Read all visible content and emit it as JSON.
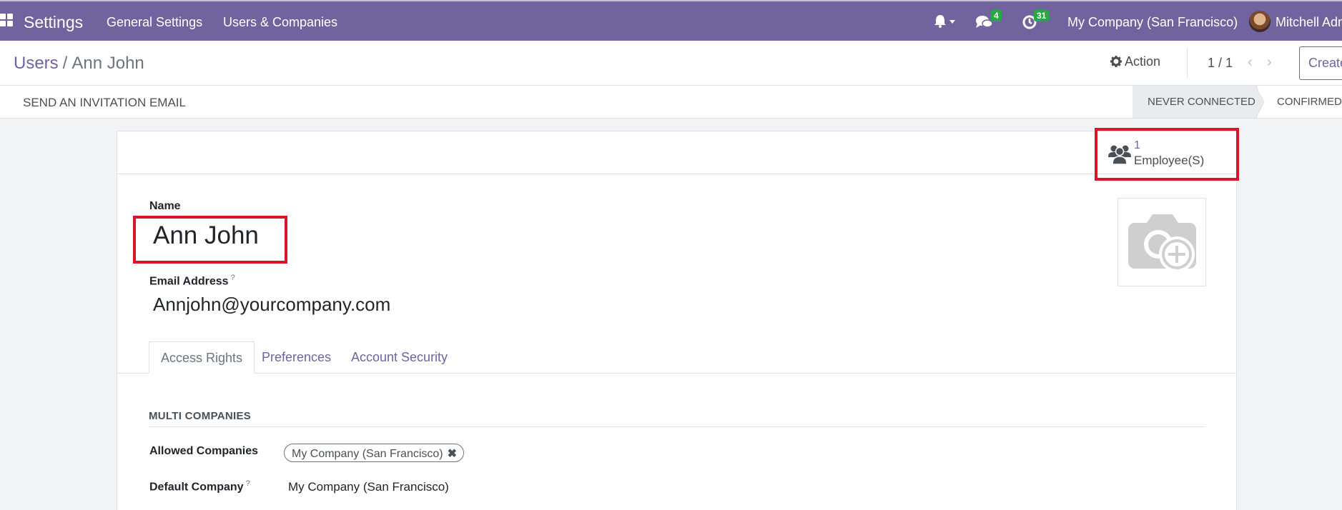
{
  "navbar": {
    "app_name": "Settings",
    "menu": [
      "General Settings",
      "Users & Companies"
    ],
    "messages_count": "4",
    "activities_count": "31",
    "company": "My Company (San Francisco)",
    "user": "Mitchell Admin"
  },
  "control_panel": {
    "breadcrumb_parent": "Users",
    "breadcrumb_sep": "/",
    "breadcrumb_current": "Ann John",
    "action_label": "Action",
    "pager": "1 / 1",
    "create_label": "Create"
  },
  "statusbar": {
    "invite_label": "SEND AN INVITATION EMAIL",
    "stages": [
      "NEVER CONNECTED",
      "CONFIRMED"
    ],
    "active_stage": "NEVER CONNECTED"
  },
  "smart_button": {
    "count": "1",
    "label": "Employee(S)"
  },
  "form": {
    "name_label": "Name",
    "name_value": "Ann John",
    "email_label": "Email Address",
    "email_value": "Annjohn@yourcompany.com",
    "help_mark": "?"
  },
  "tabs": [
    "Access Rights",
    "Preferences",
    "Account Security"
  ],
  "access_rights": {
    "section_title": "MULTI COMPANIES",
    "allowed_label": "Allowed Companies",
    "allowed_tag": "My Company (San Francisco)",
    "default_label": "Default Company",
    "default_value": "My Company (San Francisco)"
  },
  "colors": {
    "brand": "#71639e",
    "highlight": "#d9152a",
    "badge": "#28a745"
  },
  "icons": [
    "apps-grid-icon",
    "bell-icon",
    "chat-icon",
    "clock-icon",
    "gear-icon",
    "users-icon",
    "camera-plus-icon"
  ]
}
